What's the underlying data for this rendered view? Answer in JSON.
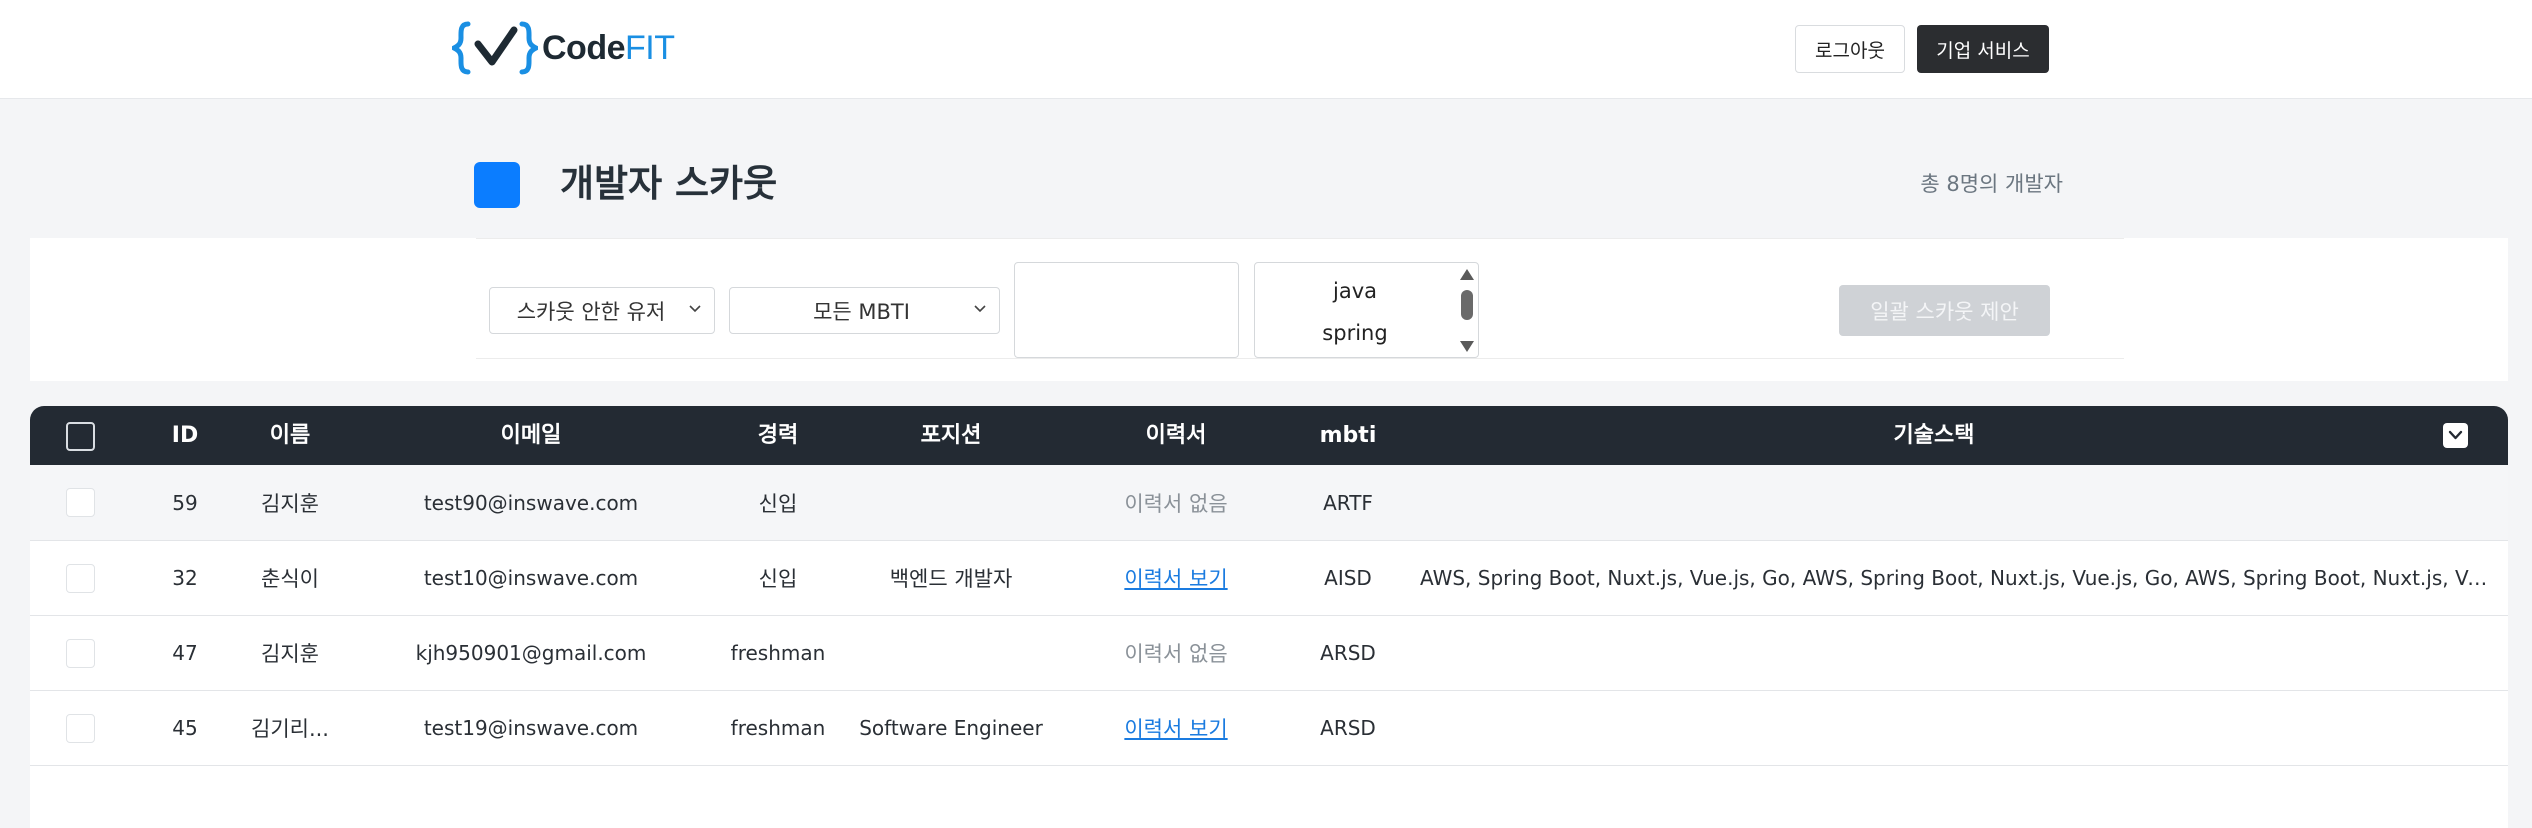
{
  "header": {
    "logo": {
      "code": "Code",
      "fit": "FIT",
      "brand_color": "#1a8fe3"
    },
    "logout_label": "로그아웃",
    "corporate_label": "기업 서비스"
  },
  "page": {
    "title": "개발자 스카웃",
    "count_text": "총 8명의 개발자",
    "accent_color": "#0b7dff"
  },
  "filters": {
    "scout_select": {
      "selected": "스카웃 안한 유저"
    },
    "mbti_select": {
      "selected": "모든 MBTI"
    },
    "search_input": {
      "value": ""
    },
    "skill_list": {
      "options": [
        "java",
        "spring"
      ]
    },
    "bulk_button_label": "일괄 스카웃 제안"
  },
  "table": {
    "columns": [
      "ID",
      "이름",
      "이메일",
      "경력",
      "포지션",
      "이력서",
      "mbti",
      "기술스택"
    ],
    "rows": [
      {
        "id": "59",
        "name": "김지훈",
        "email": "test90@inswave.com",
        "career": "신입",
        "position": "",
        "resume": "이력서 없음",
        "mbti": "ARTF",
        "skills": ""
      },
      {
        "id": "32",
        "name": "춘식이",
        "email": "test10@inswave.com",
        "career": "신입",
        "position": "백엔드 개발자",
        "resume": "이력서 보기",
        "mbti": "AISD",
        "skills": "AWS, Spring Boot, Nuxt.js, Vue.js, Go, AWS, Spring Boot, Nuxt.js, Vue.js, Go, AWS, Spring Boot, Nuxt.js, Vue.js, Go"
      },
      {
        "id": "47",
        "name": "김지훈",
        "email": "kjh950901@gmail.com",
        "career": "freshman",
        "position": "",
        "resume": "이력서 없음",
        "mbti": "ARSD",
        "skills": ""
      },
      {
        "id": "45",
        "name": "김기리...",
        "email": "test19@inswave.com",
        "career": "freshman",
        "position": "Software Engineer",
        "resume": "이력서 보기",
        "mbti": "ARSD",
        "skills": ""
      }
    ]
  }
}
